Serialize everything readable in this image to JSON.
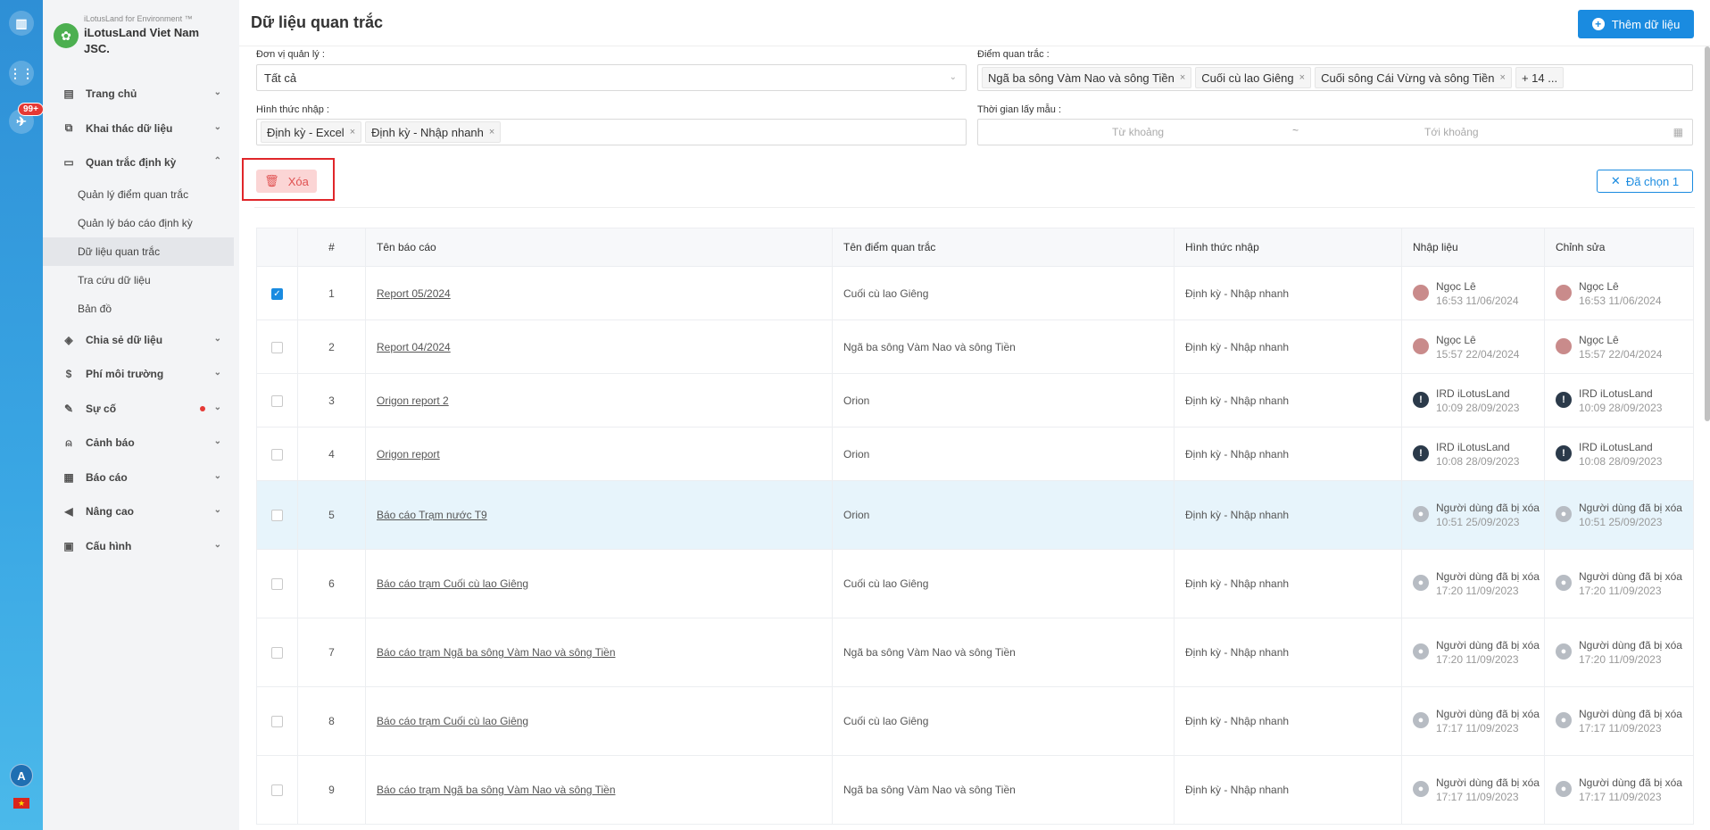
{
  "rail": {
    "badge": "99+",
    "avatar": "A",
    "flag": "★"
  },
  "brand": {
    "tag": "iLotusLand for Environment ™",
    "name": "iLotusLand Viet Nam JSC."
  },
  "menu": {
    "items": [
      {
        "label": "Trang chủ",
        "icon": "home-icon"
      },
      {
        "label": "Khai thác dữ liệu",
        "icon": "share-icon"
      },
      {
        "label": "Quan trắc định kỳ",
        "icon": "document-icon"
      },
      {
        "label": "Chia sẻ dữ liệu",
        "icon": "share-data-icon"
      },
      {
        "label": "Phí môi trường",
        "icon": "dollar-icon"
      },
      {
        "label": "Sự cố",
        "icon": "edit-icon"
      },
      {
        "label": "Cảnh báo",
        "icon": "bell-icon"
      },
      {
        "label": "Báo cáo",
        "icon": "report-icon"
      },
      {
        "label": "Nâng cao",
        "icon": "megaphone-icon"
      },
      {
        "label": "Cấu hình",
        "icon": "settings-icon"
      }
    ],
    "sub": [
      "Quản lý điểm quan trắc",
      "Quản lý báo cáo định kỳ",
      "Dữ liệu quan trắc",
      "Tra cứu dữ liệu",
      "Bản đồ"
    ]
  },
  "header": {
    "title": "Dữ liệu quan trắc",
    "add_label": "Thêm dữ liệu"
  },
  "filters": {
    "unit_label": "Đơn vị quản lý :",
    "unit_value": "Tất cả",
    "point_label": "Điểm quan trắc :",
    "point_tags": [
      "Ngã ba sông Vàm Nao và sông Tiền",
      "Cuối cù lao Giêng",
      "Cuối sông Cái Vừng và sông Tiền"
    ],
    "point_more": "+ 14 ...",
    "method_label": "Hình thức nhập :",
    "method_tags": [
      "Định kỳ - Excel",
      "Định kỳ - Nhập nhanh"
    ],
    "time_label": "Thời gian lấy mẫu :",
    "from_placeholder": "Từ khoảng",
    "to_placeholder": "Tới khoảng",
    "sep": "~"
  },
  "actions": {
    "delete_label": "Xóa",
    "selected_label": "Đã chọn 1"
  },
  "table": {
    "headers": [
      "#",
      "Tên báo cáo",
      "Tên điểm quan trắc",
      "Hình thức nhập",
      "Nhập liệu",
      "Chỉnh sửa"
    ],
    "rows": [
      {
        "n": "1",
        "name": "Report 05/2024",
        "point": "Cuối cù lao Giêng",
        "method": "Định kỳ - Nhập nhanh",
        "in_user": "Ngọc Lê",
        "in_time": "16:53 11/06/2024",
        "ed_user": "Ngọc Lê",
        "ed_time": "16:53 11/06/2024",
        "av": "p",
        "checked": true
      },
      {
        "n": "2",
        "name": "Report 04/2024",
        "point": "Ngã ba sông Vàm Nao và sông Tiền",
        "method": "Định kỳ - Nhập nhanh",
        "in_user": "Ngọc Lê",
        "in_time": "15:57 22/04/2024",
        "ed_user": "Ngọc Lê",
        "ed_time": "15:57 22/04/2024",
        "av": "p"
      },
      {
        "n": "3",
        "name": "Origon report 2",
        "point": "Orion",
        "method": "Định kỳ - Nhập nhanh",
        "in_user": "IRD iLotusLand",
        "in_time": "10:09 28/09/2023",
        "ed_user": "IRD iLotusLand",
        "ed_time": "10:09 28/09/2023",
        "av": "i"
      },
      {
        "n": "4",
        "name": "Origon report",
        "point": "Orion",
        "method": "Định kỳ - Nhập nhanh",
        "in_user": "IRD iLotusLand",
        "in_time": "10:08 28/09/2023",
        "ed_user": "IRD iLotusLand",
        "ed_time": "10:08 28/09/2023",
        "av": "i"
      },
      {
        "n": "5",
        "name": "Báo cáo Trạm nước T9",
        "point": "Orion",
        "method": "Định kỳ - Nhập nhanh",
        "in_user": "Người dùng đã bị xóa",
        "in_time": "10:51 25/09/2023",
        "ed_user": "Người dùng đã bị xóa",
        "ed_time": "10:51 25/09/2023",
        "av": "g",
        "hl": true
      },
      {
        "n": "6",
        "name": "Báo cáo trạm Cuối cù lao Giêng",
        "point": "Cuối cù lao Giêng",
        "method": "Định kỳ - Nhập nhanh",
        "in_user": "Người dùng đã bị xóa",
        "in_time": "17:20 11/09/2023",
        "ed_user": "Người dùng đã bị xóa",
        "ed_time": "17:20 11/09/2023",
        "av": "g"
      },
      {
        "n": "7",
        "name": "Báo cáo trạm Ngã ba sông Vàm Nao và sông Tiền",
        "point": "Ngã ba sông Vàm Nao và sông Tiền",
        "method": "Định kỳ - Nhập nhanh",
        "in_user": "Người dùng đã bị xóa",
        "in_time": "17:20 11/09/2023",
        "ed_user": "Người dùng đã bị xóa",
        "ed_time": "17:20 11/09/2023",
        "av": "g"
      },
      {
        "n": "8",
        "name": "Báo cáo trạm Cuối cù lao Giêng",
        "point": "Cuối cù lao Giêng",
        "method": "Định kỳ - Nhập nhanh",
        "in_user": "Người dùng đã bị xóa",
        "in_time": "17:17 11/09/2023",
        "ed_user": "Người dùng đã bị xóa",
        "ed_time": "17:17 11/09/2023",
        "av": "g"
      },
      {
        "n": "9",
        "name": "Báo cáo trạm Ngã ba sông Vàm Nao và sông Tiền",
        "point": "Ngã ba sông Vàm Nao và sông Tiền",
        "method": "Định kỳ - Nhập nhanh",
        "in_user": "Người dùng đã bị xóa",
        "in_time": "17:17 11/09/2023",
        "ed_user": "Người dùng đã bị xóa",
        "ed_time": "17:17 11/09/2023",
        "av": "g"
      }
    ]
  }
}
